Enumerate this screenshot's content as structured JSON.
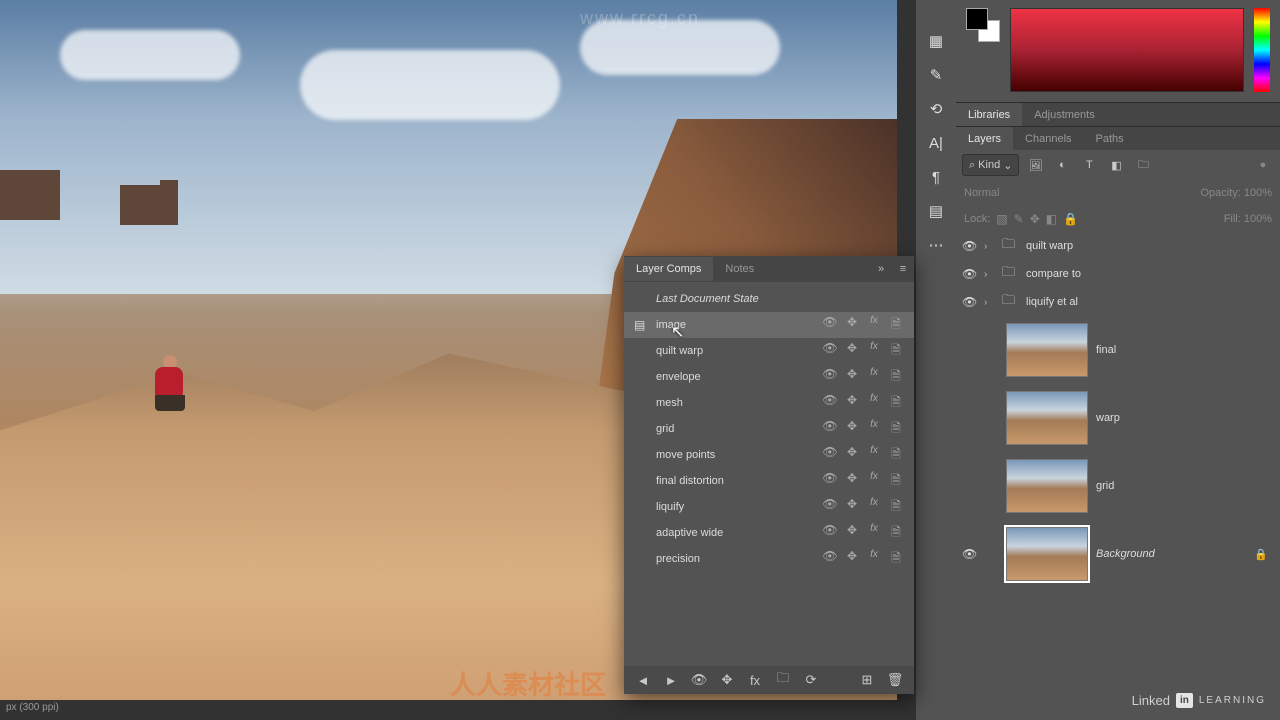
{
  "status_bar": "px (300 ppi)",
  "watermarks": {
    "top": "www.rrcg.cn",
    "bottom": "人人素材社区"
  },
  "branding": {
    "linkedin": "Linked",
    "in": "in",
    "learning": "LEARNING"
  },
  "top_tabs": {
    "libraries": "Libraries",
    "adjustments": "Adjustments"
  },
  "panel_tabs": {
    "layers": "Layers",
    "channels": "Channels",
    "paths": "Paths"
  },
  "filter": {
    "label": "Kind",
    "search_glyph": "⌕",
    "chev": "⌄"
  },
  "blend": {
    "mode": "Normal",
    "opacity_label": "Opacity:",
    "opacity_value": "100%"
  },
  "lock": {
    "label": "Lock:",
    "fill_label": "Fill:",
    "fill_value": "100%"
  },
  "layers": {
    "groups": [
      {
        "name": "quilt warp"
      },
      {
        "name": "compare to"
      },
      {
        "name": "liquify et al"
      }
    ],
    "thumbs": [
      {
        "name": "final",
        "eye": false
      },
      {
        "name": "warp",
        "eye": false
      },
      {
        "name": "grid",
        "eye": false
      }
    ],
    "background": {
      "name": "Background",
      "eye": true,
      "selected": true
    }
  },
  "float_panel": {
    "tabs": {
      "layer_comps": "Layer Comps",
      "notes": "Notes"
    },
    "last_state": "Last Document State",
    "comps": [
      {
        "name": "image",
        "selected": true
      },
      {
        "name": "quilt warp"
      },
      {
        "name": "envelope"
      },
      {
        "name": "mesh"
      },
      {
        "name": "grid"
      },
      {
        "name": "move points"
      },
      {
        "name": "final distortion"
      },
      {
        "name": "liquify"
      },
      {
        "name": "adaptive wide"
      },
      {
        "name": "precision"
      }
    ],
    "row_icons": {
      "vis": "👁",
      "move": "✥",
      "fx": "fx",
      "doc": "🗎"
    },
    "footer": {
      "prev": "◄",
      "next": "►",
      "vis": "👁",
      "move": "✥",
      "fx": "fx",
      "folder": "🗀",
      "refresh": "⟳",
      "new": "⊞",
      "trash": "🗑"
    }
  },
  "icons_col": [
    "▦",
    "✎",
    "⟲",
    "A|",
    "¶",
    "▤",
    "⋯"
  ],
  "filter_icons": [
    "🖼",
    "◐",
    "T",
    "◧",
    "🗀"
  ],
  "lock_icons": [
    "▧",
    "✎",
    "✥",
    "◧",
    "🔒"
  ]
}
